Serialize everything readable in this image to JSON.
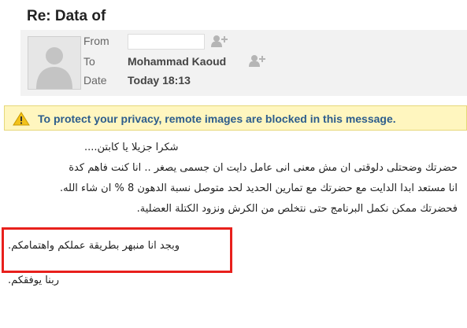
{
  "email": {
    "subject": "Re: Data of",
    "from_label": "From",
    "from_value": "",
    "to_label": "To",
    "to_value": "Mohammad Kaoud",
    "date_label": "Date",
    "date_value": "Today 18:13"
  },
  "privacy_notice": {
    "text": "To protect your privacy, remote images are blocked in this message.",
    "icon": "warning-icon"
  },
  "body": {
    "lines": [
      "شكرا جزيلا يا كابتن....",
      "حضرتك وضحتلى دلوقتى ان مش معنى انى عامل دايت ان جسمى يصغر .. انا كنت فاهم كدة",
      "انا مستعد ابدا الدايت مع حضرتك مع تمارين الحديد لحد متوصل نسبة الدهون 8 % ان شاء الله.",
      "فحضرتك ممكن نكمل البرنامج حتى نتخلص من الكرش ونزود الكتلة العضلية."
    ],
    "highlighted_line": "وبجد انا منبهر بطريقة عملكم واهتمامكم.",
    "closing": "ربنا يوفقكم."
  },
  "colors": {
    "header_bg": "#f2f2f2",
    "notice_bg": "#fff6bf",
    "notice_text": "#2d5d8c",
    "highlight_border": "#e8201c"
  }
}
